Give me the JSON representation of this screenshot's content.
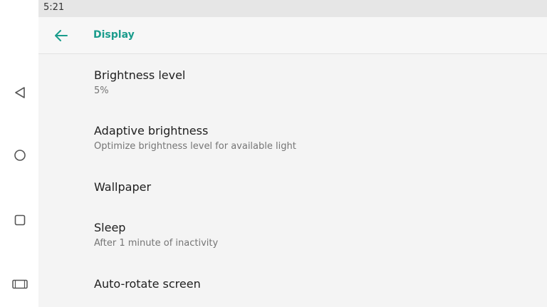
{
  "status_bar": {
    "time": "5:21"
  },
  "app_bar": {
    "title": "Display",
    "back_icon": "arrow-left-icon"
  },
  "nav_bar": {
    "buttons": [
      {
        "name": "back",
        "icon": "triangle-back-icon"
      },
      {
        "name": "home",
        "icon": "circle-home-icon"
      },
      {
        "name": "recents",
        "icon": "square-recents-icon"
      },
      {
        "name": "screenshot",
        "icon": "rectangle-screenshot-icon"
      }
    ]
  },
  "settings": [
    {
      "title": "Brightness level",
      "summary": "5%"
    },
    {
      "title": "Adaptive brightness",
      "summary": "Optimize brightness level for available light"
    },
    {
      "title": "Wallpaper",
      "summary": ""
    },
    {
      "title": "Sleep",
      "summary": "After 1 minute of inactivity"
    },
    {
      "title": "Auto-rotate screen",
      "summary": ""
    }
  ],
  "colors": {
    "accent": "#1a9c8c",
    "status_bar_bg": "#e6e6e6",
    "app_bar_bg": "#f7f7f7",
    "screen_bg": "#f4f4f4",
    "title_text": "#202020",
    "summary_text": "#757575"
  }
}
